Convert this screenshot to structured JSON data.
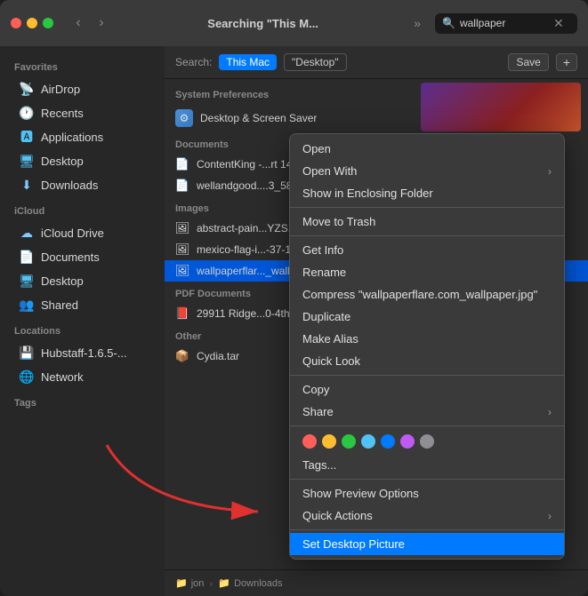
{
  "titlebar": {
    "title": "Searching \"This M...",
    "search_placeholder": "wallpaper",
    "search_value": "wallpaper"
  },
  "search_toolbar": {
    "label": "Search:",
    "scope_this_mac": "This Mac",
    "scope_desktop": "\"Desktop\"",
    "save_label": "Save",
    "plus_label": "+"
  },
  "sidebar": {
    "favorites_label": "Favorites",
    "icloud_label": "iCloud",
    "locations_label": "Locations",
    "tags_label": "Tags",
    "items": {
      "airdrop": "AirDrop",
      "recents": "Recents",
      "applications": "Applications",
      "desktop": "Desktop",
      "downloads": "Downloads",
      "icloud_drive": "iCloud Drive",
      "documents": "Documents",
      "icloud_desktop": "Desktop",
      "shared": "Shared",
      "hubstaff": "Hubstaff-1.6.5-...",
      "network": "Network"
    }
  },
  "file_groups": {
    "system_preferences": {
      "label": "System Preferences",
      "items": [
        "Desktop & Screen Saver"
      ]
    },
    "documents": {
      "label": "Documents",
      "items": [
        "ContentKing -...rt 147...",
        "wellandgood....3_58_..."
      ]
    },
    "images": {
      "label": "Images",
      "items": [
        "abstract-pain...YZS...",
        "mexico-flag-i...-37-1...",
        "wallpaperflar..._wallp..."
      ]
    },
    "pdf_documents": {
      "label": "PDF Documents",
      "items": [
        "29911 Ridge...0-4th c..."
      ]
    },
    "other": {
      "label": "Other",
      "items": [
        "Cydia.tar"
      ]
    }
  },
  "context_menu": {
    "items": [
      {
        "label": "Open",
        "has_arrow": false
      },
      {
        "label": "Open With",
        "has_arrow": true
      },
      {
        "label": "Show in Enclosing Folder",
        "has_arrow": false
      },
      {
        "separator": true
      },
      {
        "label": "Move to Trash",
        "has_arrow": false
      },
      {
        "separator": true
      },
      {
        "label": "Get Info",
        "has_arrow": false
      },
      {
        "label": "Rename",
        "has_arrow": false
      },
      {
        "label": "Compress \"wallpaperflare.com_wallpaper.jpg\"",
        "has_arrow": false
      },
      {
        "label": "Duplicate",
        "has_arrow": false
      },
      {
        "label": "Make Alias",
        "has_arrow": false
      },
      {
        "label": "Quick Look",
        "has_arrow": false
      },
      {
        "separator": true
      },
      {
        "label": "Copy",
        "has_arrow": false
      },
      {
        "label": "Share",
        "has_arrow": true
      },
      {
        "separator": true
      },
      {
        "tags": true
      },
      {
        "label": "Tags...",
        "has_arrow": false
      },
      {
        "separator": true
      },
      {
        "label": "Show Preview Options",
        "has_arrow": false
      },
      {
        "label": "Quick Actions",
        "has_arrow": true
      },
      {
        "separator": true
      },
      {
        "label": "Set Desktop Picture",
        "has_arrow": false,
        "highlighted": true
      }
    ],
    "tag_colors": [
      "#ff5f57",
      "#febc2e",
      "#28c840",
      "#4fc3f7",
      "#007aff",
      "#bf5af2",
      "#8e8e93"
    ]
  },
  "bottom_bar": {
    "path": [
      "jon",
      "Downloads"
    ]
  }
}
